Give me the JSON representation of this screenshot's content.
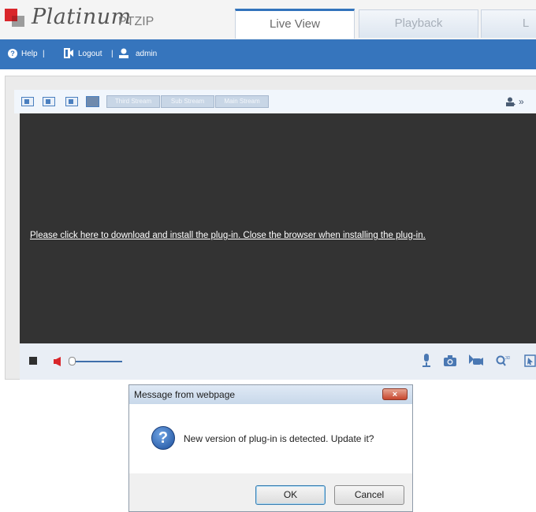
{
  "header": {
    "brand": "Platinum",
    "model": "PTZIP",
    "tabs": [
      {
        "label": "Live View",
        "active": true
      },
      {
        "label": "Playback",
        "active": false
      },
      {
        "label": "L",
        "active": false
      }
    ]
  },
  "topbar": {
    "help": "Help",
    "logout": "Logout",
    "user": "admin",
    "separator": "|"
  },
  "toolbar": {
    "streams": [
      "Third Stream",
      "Sub Stream",
      "Main Stream"
    ]
  },
  "video": {
    "plugin_message": "Please click here to download and install the plug-in. Close the browser when installing the plug-in."
  },
  "controls": {
    "volume_level": 0.05
  },
  "dialog": {
    "title": "Message from webpage",
    "close_glyph": "×",
    "message": "New version of plug-in is detected. Update it?",
    "ok": "OK",
    "cancel": "Cancel"
  },
  "colors": {
    "accent": "#3675bd",
    "video_bg": "#333333",
    "logo_red": "#d9262b"
  }
}
